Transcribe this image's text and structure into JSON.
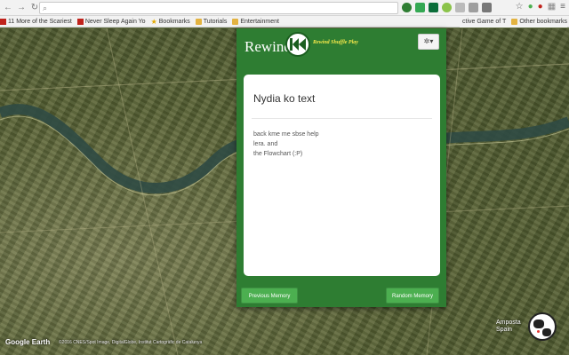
{
  "browser": {
    "address": "",
    "bookmarks": [
      {
        "label": "11 More of the Scariest",
        "icon": "red"
      },
      {
        "label": "Never Sleep Again Yo",
        "icon": "red"
      },
      {
        "label": "Bookmarks",
        "icon": "star"
      },
      {
        "label": "Tutorials",
        "icon": "folder"
      },
      {
        "label": "Entertainment",
        "icon": "folder"
      }
    ],
    "bookmark_right": "ctive Game of T",
    "other_bookmarks": "Other bookmarks"
  },
  "map": {
    "logo": "Google Earth",
    "attribution": "©2016 CNES/Spot Image, DigitalGlobe, Institut Cartogràfic de Catalunya",
    "place_line1": "Amposta",
    "place_line2": "Spain"
  },
  "popup": {
    "brand": "Rewind",
    "tagline": "Rewind Shuffle Play",
    "settings_caret": "▾",
    "card_title": "Nydia ko text",
    "card_lines": [
      "back kme me sbse help",
      "lera. and",
      "the Flowchart (:P)"
    ],
    "prev_button": "Previous Memory",
    "random_button": "Random Memory"
  },
  "colors": {
    "accent": "#2e7d32",
    "button": "#4caf50",
    "tagline": "#f5e84a"
  }
}
